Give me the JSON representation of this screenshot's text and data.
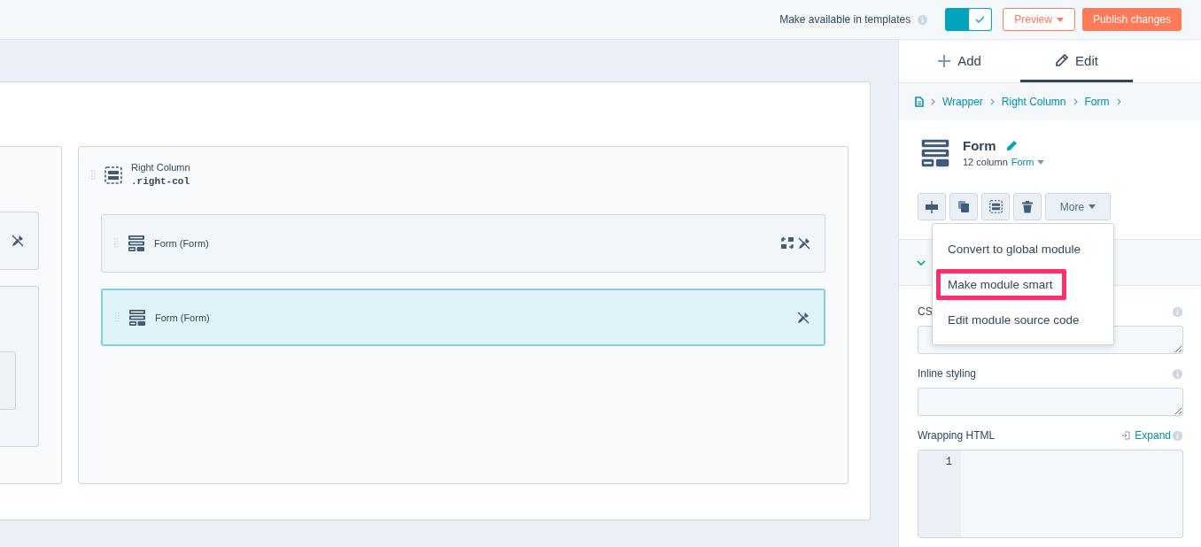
{
  "top_bar": {
    "availability_label": "Make available in templates",
    "availability_toggle": {
      "on": true
    },
    "preview_button": "Preview",
    "publish_button": "Publish changes"
  },
  "canvas": {
    "right_column": {
      "name": "Right Column",
      "class_name": ".right-col",
      "modules": [
        {
          "label": "Form (Form)",
          "selected": false,
          "actions": [
            {
              "kind": "swap"
            },
            {
              "kind": "unpin"
            }
          ]
        },
        {
          "label": "Form (Form)",
          "selected": true,
          "actions": [
            {
              "kind": "unpin"
            }
          ]
        }
      ]
    }
  },
  "sidebar": {
    "tabs": [
      {
        "label": "Add",
        "kind": "add",
        "selected": false
      },
      {
        "label": "Edit",
        "kind": "edit",
        "selected": true
      }
    ],
    "breadcrumb": [
      "Wrapper",
      "Right Column",
      "Form"
    ],
    "module": {
      "title": "Form",
      "subtitle": "12 column",
      "type_link": "Form"
    },
    "more_button": "More",
    "menu": [
      {
        "label": "Convert to global module",
        "highlighted": false
      },
      {
        "label": "Make module smart",
        "highlighted": true
      },
      {
        "label": "Edit module source code",
        "highlighted": false
      }
    ],
    "fields": [
      {
        "label": "CS",
        "kind": "text"
      },
      {
        "label": "Inline styling",
        "kind": "text"
      },
      {
        "label": "Wrapping HTML",
        "kind": "code",
        "expand_link": "Expand",
        "line_number": "1"
      }
    ]
  }
}
